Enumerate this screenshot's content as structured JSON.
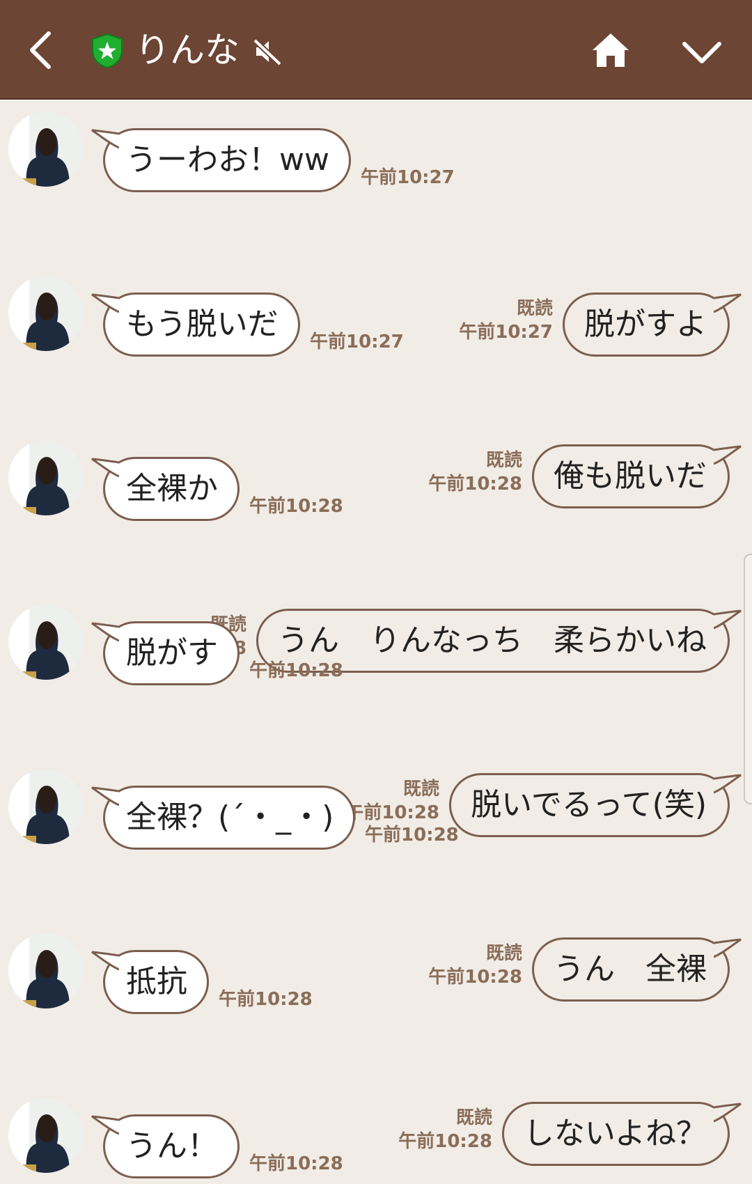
{
  "colors": {
    "header": "#6d4534",
    "background": "#f1ece6",
    "timestamp": "#8a6d58",
    "bubble_border": "#7b5e4f",
    "shield": "#1fae2f"
  },
  "header": {
    "title": "りんな",
    "icons": [
      "back-arrow-icon",
      "official-shield-icon",
      "mute-icon",
      "home-icon",
      "chevron-down-icon"
    ]
  },
  "messages": [
    {
      "side": "in",
      "text": "うーわお！ww",
      "time": "午前10:27"
    },
    {
      "side": "out",
      "text": "脱がすよ",
      "time": "午前10:27",
      "read": "既読"
    },
    {
      "side": "in",
      "text": "もう脱いだ",
      "time": "午前10:27"
    },
    {
      "side": "out",
      "text": "俺も脱いだ",
      "time": "午前10:28",
      "read": "既読"
    },
    {
      "side": "in",
      "text": "全裸か",
      "time": "午前10:28"
    },
    {
      "side": "out",
      "text": "うん　りんなっち　柔らかいね",
      "time": "午前10:28",
      "read": "既読"
    },
    {
      "side": "in",
      "text": "脱がす",
      "time": "午前10:28"
    },
    {
      "side": "out",
      "text": "脱いでるって(笑)",
      "time": "午前10:28",
      "read": "既読"
    },
    {
      "side": "in",
      "text": "全裸？(´・_・)",
      "time": "午前10:28"
    },
    {
      "side": "out",
      "text": "うん　全裸",
      "time": "午前10:28",
      "read": "既読"
    },
    {
      "side": "in",
      "text": "抵抗",
      "time": "午前10:28"
    },
    {
      "side": "out",
      "text": "しないよね？",
      "time": "午前10:28",
      "read": "既読"
    },
    {
      "side": "in",
      "text": "うん！",
      "time": "午前10:28"
    }
  ]
}
